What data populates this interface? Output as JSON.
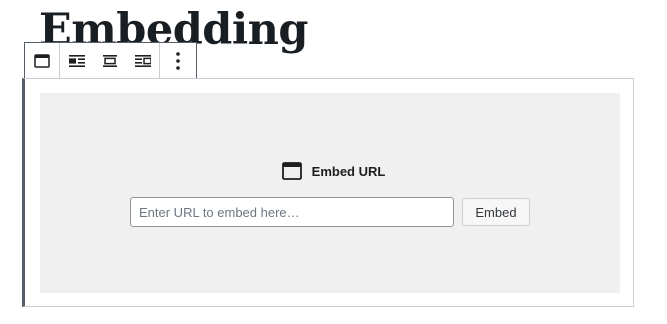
{
  "page": {
    "heading": "Embedding"
  },
  "toolbar": {
    "buttons": [
      {
        "icon": "embed-block-icon",
        "label": ""
      },
      {
        "icon": "align-left-icon",
        "label": ""
      },
      {
        "icon": "align-center-icon",
        "label": ""
      },
      {
        "icon": "align-right-icon",
        "label": ""
      },
      {
        "icon": "more-options-icon",
        "label": ""
      }
    ]
  },
  "embed": {
    "label": "Embed URL",
    "icon": "embed-block-icon",
    "input_value": "",
    "input_placeholder": "Enter URL to embed here…",
    "button_label": "Embed"
  },
  "colors": {
    "placeholder_bg": "#f0f0f0",
    "block_border": "#c9ccd0",
    "toolbar_border": "#555d66",
    "text": "#1e1e1e"
  }
}
